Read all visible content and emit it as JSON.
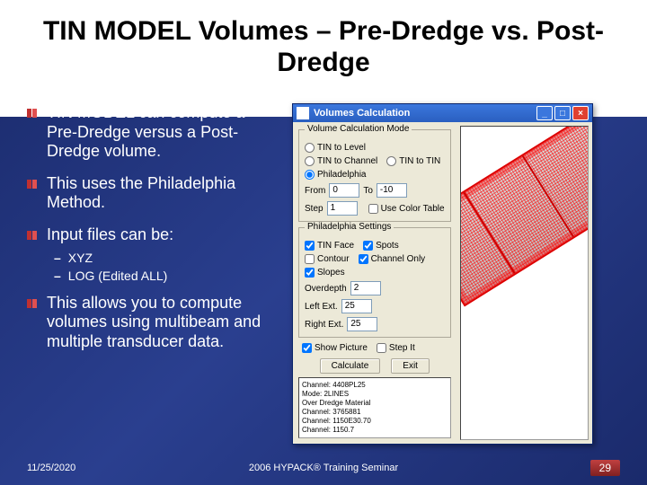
{
  "slide": {
    "title": "TIN MODEL Volumes – Pre-Dredge vs. Post-Dredge",
    "bullets": [
      "TIN MODEL can compute a Pre-Dredge versus a Post-Dredge volume.",
      "This uses the Philadelphia Method.",
      "Input files can be:",
      "This allows you to compute volumes using multibeam and multiple transducer data."
    ],
    "sub_bullets": [
      "XYZ",
      "LOG (Edited ALL)"
    ]
  },
  "footer": {
    "date": "11/25/2020",
    "center": "2006 HYPACK® Training Seminar",
    "page": "29"
  },
  "dialog": {
    "title": "Volumes Calculation",
    "group_mode": {
      "legend": "Volume Calculation Mode",
      "opt_tin_level": "TIN to Level",
      "opt_tin_channel": "TIN to Channel",
      "opt_tin_tin": "TIN to TIN",
      "opt_philly": "Philadelphia",
      "from_label": "From",
      "from_value": "0",
      "to_label": "To",
      "to_value": "-10",
      "step_label": "Step",
      "step_value": "1",
      "use_color": "Use Color Table"
    },
    "group_philly": {
      "legend": "Philadelphia Settings",
      "opt_tin_face": "TIN Face",
      "opt_spots": "Spots",
      "opt_contour": "Contour",
      "opt_chan_only": "Channel Only",
      "opt_slopes": "Slopes",
      "overdepth_label": "Overdepth",
      "overdepth_value": "2",
      "left_ext_label": "Left Ext.",
      "left_ext_value": "25",
      "right_ext_label": "Right Ext.",
      "right_ext_value": "25"
    },
    "show_picture": "Show Picture",
    "step_it": "Step It",
    "btn_calc": "Calculate",
    "btn_exit": "Exit",
    "info": "Channel: 4408PL25\nMode: 2LINES\nOver Dredge Material\nChannel: 3765881\nChannel: 1150E30.70\nChannel: 1150.7\n"
  }
}
